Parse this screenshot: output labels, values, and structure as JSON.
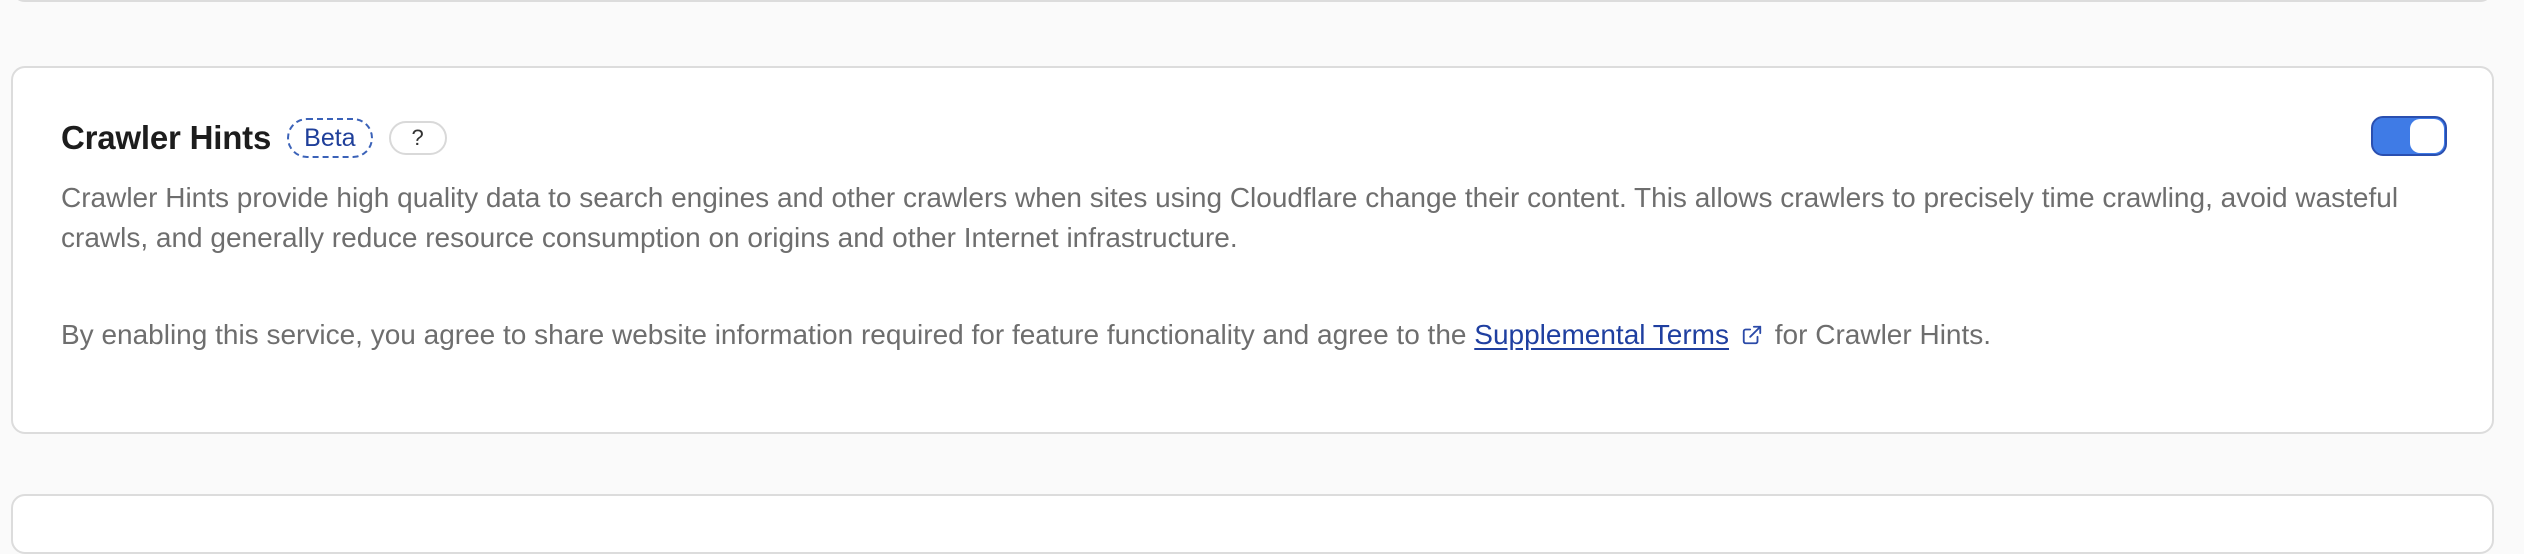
{
  "card": {
    "title": "Crawler Hints",
    "badge": "Beta",
    "help_label": "?",
    "toggle_on": true,
    "description": "Crawler Hints provide high quality data to search engines and other crawlers when sites using Cloudflare change their content. This allows crawlers to precisely time crawling, avoid wasteful crawls, and generally reduce resource consumption on origins and other Internet infrastructure.",
    "agreement_prefix": "By enabling this service, you agree to share website information required for feature functionality and agree to the",
    "terms_link": "Supplemental Terms",
    "agreement_suffix": "for Crawler Hints."
  },
  "icons": {
    "external_link": "external-link-icon"
  },
  "colors": {
    "toggle_on": "#3f7be6",
    "link": "#1f3fa0",
    "badge_border": "#3b62b8"
  }
}
